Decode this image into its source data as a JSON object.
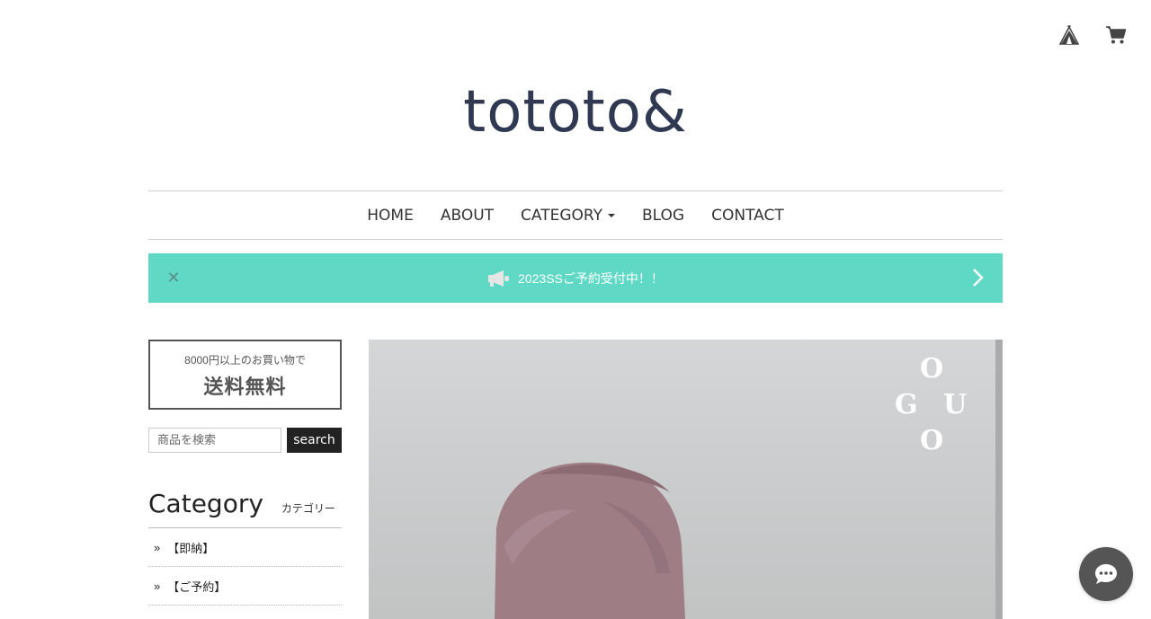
{
  "header": {
    "logo": "tototo&",
    "icons": [
      "tent-icon",
      "cart-icon"
    ]
  },
  "nav": {
    "items": [
      "HOME",
      "ABOUT",
      "CATEGORY",
      "BLOG",
      "CONTACT"
    ]
  },
  "banner": {
    "message": "2023SSご予約受付中！！",
    "background": "#5fd8c5"
  },
  "sidebar": {
    "shipping_small": "8000円以上のお買い物で",
    "shipping_big": "送料無料",
    "search_placeholder": "商品を検索",
    "search_button": "search",
    "category_title": "Category",
    "category_subtitle": "カテゴリー",
    "categories": [
      "【即納】",
      "【ご予約】"
    ]
  },
  "hero": {
    "brand_letters": [
      "O",
      "G",
      "U",
      "O"
    ]
  },
  "colors": {
    "logo": "#2f3a52",
    "accent": "#5fd8c5",
    "chat": "#555555"
  }
}
